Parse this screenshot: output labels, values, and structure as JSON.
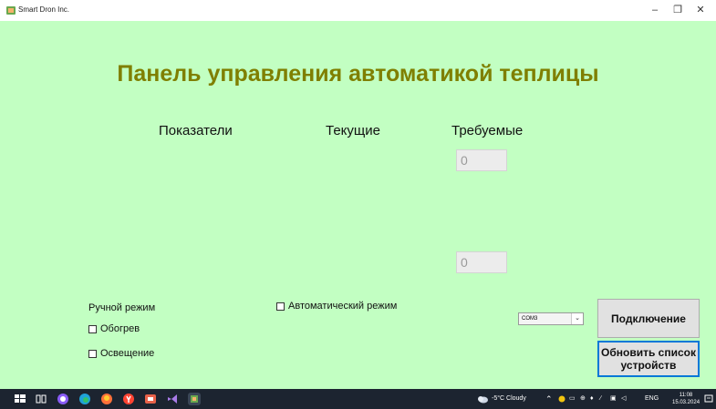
{
  "window": {
    "title": "Smart Dron Inc.",
    "minimize_glyph": "–",
    "maximize_glyph": "❐",
    "close_glyph": "✕"
  },
  "main": {
    "title": "Панель управления автоматикой теплицы",
    "columns": {
      "indicators": "Показатели",
      "current": "Текущие",
      "required": "Требуемые"
    },
    "required_values": [
      "0",
      "0"
    ]
  },
  "modes": {
    "manual_label": "Ручной режим",
    "heating_label": "Обогрев",
    "lighting_label": "Освещение",
    "auto_label": "Автоматический режим"
  },
  "connection": {
    "port_selected": "COM3",
    "connect_label": "Подключение",
    "refresh_label": "Обновить список устройств"
  },
  "taskbar": {
    "weather": "-5°C  Cloudy",
    "language": "ENG",
    "time": "11:08",
    "date": "15.03.2024"
  },
  "colors": {
    "client_bg": "#c2ffc2",
    "title_color": "#7f7f00",
    "taskbar_bg": "#1c2430",
    "focus_border": "#0078d7"
  },
  "icons": [
    "app-icon",
    "start-icon",
    "task-view-icon",
    "alice-icon",
    "edge-icon",
    "firefox-icon",
    "yandex-browser-icon",
    "app-tile-icon",
    "visual-studio-icon",
    "running-app-icon",
    "weather-cloud-icon",
    "chevron-up-icon",
    "notification-icon"
  ]
}
